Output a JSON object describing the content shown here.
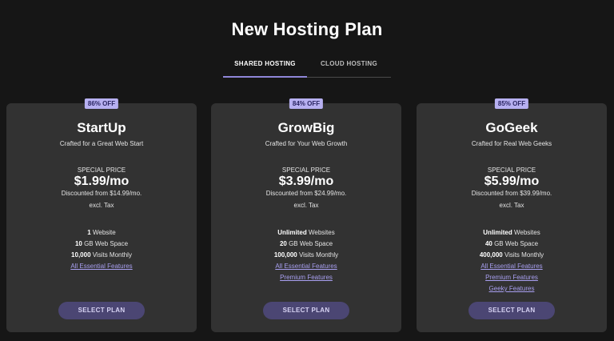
{
  "page": {
    "title": "New Hosting Plan"
  },
  "tabs": [
    {
      "label": "SHARED HOSTING",
      "active": true
    },
    {
      "label": "CLOUD HOSTING",
      "active": false
    }
  ],
  "colors": {
    "background": "#161616",
    "card": "#323232",
    "accent": "#a89ff0",
    "badge": "#b7b0f1",
    "button": "#4b4673"
  },
  "plans": [
    {
      "badge": "86% OFF",
      "name": "StartUp",
      "tagline": "Crafted for a Great Web Start",
      "special_label": "SPECIAL PRICE",
      "price": "$1.99/mo",
      "discount": "Discounted from $14.99/mo.",
      "tax": "excl. Tax",
      "features": [
        {
          "bold": "1",
          "text": " Website"
        },
        {
          "bold": "10",
          "text": " GB Web Space"
        },
        {
          "bold": "10,000",
          "text": " Visits Monthly"
        }
      ],
      "links": [
        "All Essential Features"
      ],
      "button": "SELECT PLAN"
    },
    {
      "badge": "84% OFF",
      "name": "GrowBig",
      "tagline": "Crafted for Your Web Growth",
      "special_label": "SPECIAL PRICE",
      "price": "$3.99/mo",
      "discount": "Discounted from $24.99/mo.",
      "tax": "excl. Tax",
      "features": [
        {
          "bold": "Unlimited",
          "text": " Websites"
        },
        {
          "bold": "20",
          "text": " GB Web Space"
        },
        {
          "bold": "100,000",
          "text": " Visits Monthly"
        }
      ],
      "links": [
        "All Essential Features",
        "Premium Features"
      ],
      "button": "SELECT PLAN"
    },
    {
      "badge": "85% OFF",
      "name": "GoGeek",
      "tagline": "Crafted for Real Web Geeks",
      "special_label": "SPECIAL PRICE",
      "price": "$5.99/mo",
      "discount": "Discounted from $39.99/mo.",
      "tax": "excl. Tax",
      "features": [
        {
          "bold": "Unlimited",
          "text": " Websites"
        },
        {
          "bold": "40",
          "text": " GB Web Space"
        },
        {
          "bold": "400,000",
          "text": " Visits Monthly"
        }
      ],
      "links": [
        "All Essential Features",
        "Premium Features",
        "Geeky Features"
      ],
      "button": "SELECT PLAN"
    }
  ]
}
